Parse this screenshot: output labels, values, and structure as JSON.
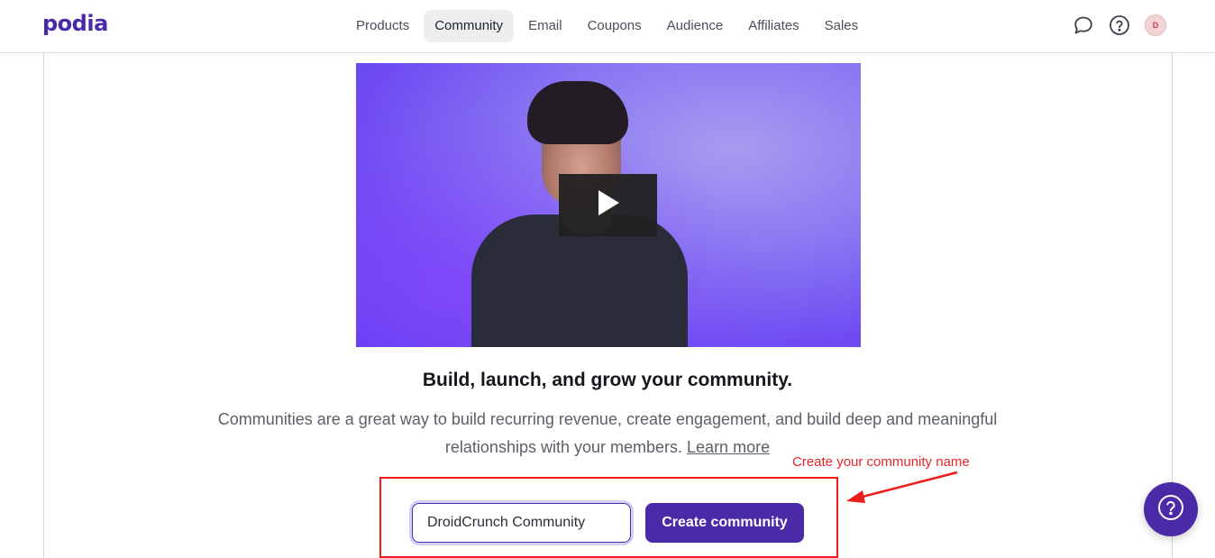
{
  "app": {
    "logo": "podia",
    "brand_color": "#4b2aa8"
  },
  "nav": {
    "items": [
      {
        "label": "Products",
        "active": false
      },
      {
        "label": "Community",
        "active": true
      },
      {
        "label": "Email",
        "active": false
      },
      {
        "label": "Coupons",
        "active": false
      },
      {
        "label": "Audience",
        "active": false
      },
      {
        "label": "Affiliates",
        "active": false
      },
      {
        "label": "Sales",
        "active": false
      }
    ]
  },
  "header_icons": {
    "chat": "chat-bubble-icon",
    "help": "help-circle-icon",
    "avatar_initial": "D"
  },
  "video": {
    "play_icon": "play-icon"
  },
  "content": {
    "headline": "Build, launch, and grow your community.",
    "description": "Communities are a great way to build recurring revenue, create engagement, and build deep and meaningful relationships with your members.",
    "learn_more": "Learn more"
  },
  "form": {
    "community_name_value": "DroidCrunch Community",
    "create_button": "Create community"
  },
  "annotation": {
    "label": "Create your community name",
    "color": "#e8262a"
  },
  "help_fab": {
    "icon": "help-circle-icon"
  }
}
